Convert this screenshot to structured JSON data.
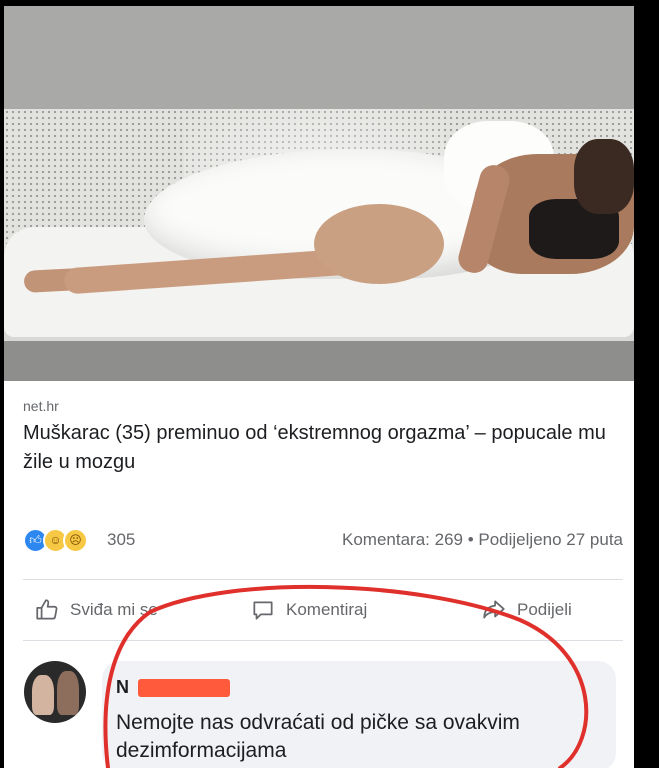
{
  "article": {
    "source": "net.hr",
    "headline": "Muškarac (35) preminuo od ‘ekstremnog orgazma’ – popucale mu žile u mozgu"
  },
  "stats": {
    "reactions": [
      "like",
      "haha",
      "wow"
    ],
    "reaction_count": "305",
    "comments_shares": "Komentara: 269 • Podijeljeno 27 puta"
  },
  "actions": {
    "like_label": "Sviđa mi se",
    "comment_label": "Komentiraj",
    "share_label": "Podijeli"
  },
  "comment": {
    "name": "N",
    "text": "Nemojte nas odvraćati od pičke sa ovakvim dezimformacijama"
  },
  "colors": {
    "brand_blue": "#2d87f0",
    "annotation_red": "#e0302b",
    "redaction_orange": "#ff5a3c"
  }
}
